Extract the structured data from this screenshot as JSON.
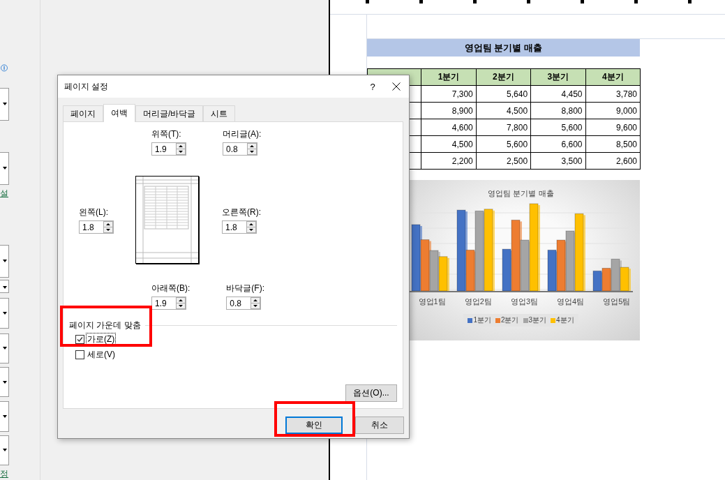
{
  "left_panel": {
    "link_fragments": [
      {
        "text": "설"
      },
      {
        "text": "정"
      }
    ]
  },
  "sheet": {
    "title": "영업팀 분기별 매출",
    "table": {
      "columns": [
        "1분기",
        "2분기",
        "3분기",
        "4분기"
      ],
      "rows": [
        [
          "7,300",
          "5,640",
          "4,450",
          "3,780"
        ],
        [
          "8,900",
          "4,500",
          "8,800",
          "9,000"
        ],
        [
          "4,600",
          "7,800",
          "5,600",
          "9,600"
        ],
        [
          "4,500",
          "5,600",
          "6,600",
          "8,500"
        ],
        [
          "2,200",
          "2,500",
          "3,500",
          "2,600"
        ]
      ]
    },
    "chart": {
      "title": "영업팀 분기별 매출",
      "categories": [
        "영업1팀",
        "영업2팀",
        "영업3팀",
        "영업4팀",
        "영업5팀"
      ],
      "legend": [
        {
          "label": "1분기",
          "color": "#4472c4"
        },
        {
          "label": "2분기",
          "color": "#ed7d31"
        },
        {
          "label": "3분기",
          "color": "#a5a5a5"
        },
        {
          "label": "4분기",
          "color": "#ffc000"
        }
      ]
    }
  },
  "dialog": {
    "title": "페이지 설정",
    "help": "?",
    "tabs": [
      {
        "label": "페이지",
        "selected": false
      },
      {
        "label": "여백",
        "selected": true
      },
      {
        "label": "머리글/바닥글",
        "selected": false
      },
      {
        "label": "시트",
        "selected": false
      }
    ],
    "margins": [
      {
        "label": "위쪽(T):",
        "value": "1.9"
      },
      {
        "label": "머리글(A):",
        "value": "0.8"
      },
      {
        "label": "왼쪽(L):",
        "value": "1.8"
      },
      {
        "label": "오른쪽(R):",
        "value": "1.8"
      },
      {
        "label": "아래쪽(B):",
        "value": "1.9"
      },
      {
        "label": "바닥글(F):",
        "value": "0.8"
      }
    ],
    "center_on_page": {
      "label": "페이지 가운데 맞춤",
      "options": [
        {
          "label": "가로(Z)",
          "checked": true,
          "focused": true,
          "highlighted": true
        },
        {
          "label": "세로(V)",
          "checked": false,
          "focused": false,
          "highlighted": false
        }
      ]
    },
    "options_button": "옵션(O)...",
    "buttons": [
      {
        "label": "확인",
        "default": true,
        "highlighted": true
      },
      {
        "label": "취소",
        "default": false,
        "highlighted": false
      }
    ]
  }
}
